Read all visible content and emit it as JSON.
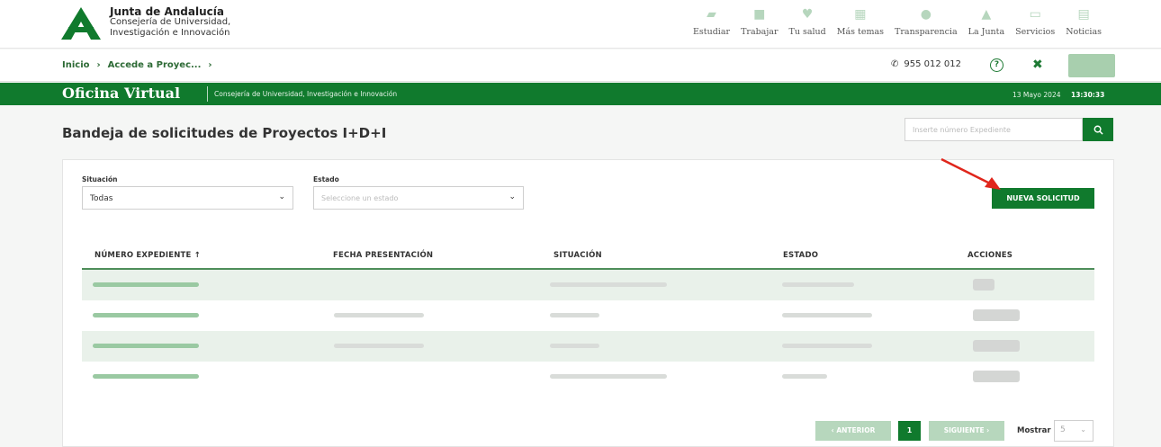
{
  "header": {
    "org_name": "Junta de Andalucía",
    "org_sub1": "Consejería de Universidad,",
    "org_sub2": "Investigación e Innovación",
    "nav": [
      {
        "label": "Estudiar",
        "icon": "graduation-cap-icon"
      },
      {
        "label": "Trabajar",
        "icon": "briefcase-icon"
      },
      {
        "label": "Tu salud",
        "icon": "heart-pulse-icon"
      },
      {
        "label": "Más temas",
        "icon": "grid-icon"
      },
      {
        "label": "Transparencia",
        "icon": "drop-icon"
      },
      {
        "label": "La Junta",
        "icon": "junta-logo-icon"
      },
      {
        "label": "Servicios",
        "icon": "laptop-icon"
      },
      {
        "label": "Noticias",
        "icon": "newspaper-icon"
      }
    ]
  },
  "breadcrumb": {
    "items": [
      "Inicio",
      "Accede a Proyec..."
    ],
    "phone": "955 012 012"
  },
  "greenbar": {
    "title": "Oficina Virtual",
    "subtitle": "Consejería de Universidad, Investigación e Innovación",
    "date": "13 Mayo 2024",
    "time": "13:30:33"
  },
  "page": {
    "title": "Bandeja de solicitudes de Proyectos I+D+I",
    "search_placeholder": "Inserte número Expediente"
  },
  "filters": {
    "situacion_label": "Situación",
    "situacion_value": "Todas",
    "estado_label": "Estado",
    "estado_placeholder": "Seleccione un estado",
    "new_button": "NUEVA SOLICITUD"
  },
  "table": {
    "headers": [
      "NÚMERO EXPEDIENTE",
      "FECHA PRESENTACIÓN",
      "SITUACIÓN",
      "ESTADO",
      "ACCIONES"
    ],
    "sort_indicator": "↑"
  },
  "pagination": {
    "prev": "‹ ANTERIOR",
    "current": "1",
    "next": "SIGUIENTE ›",
    "show_label": "Mostrar",
    "page_size": "5"
  },
  "colors": {
    "brand_green": "#107a2d",
    "row_alt": "#e9f1ea",
    "disabled_green": "#b7d7bd"
  }
}
